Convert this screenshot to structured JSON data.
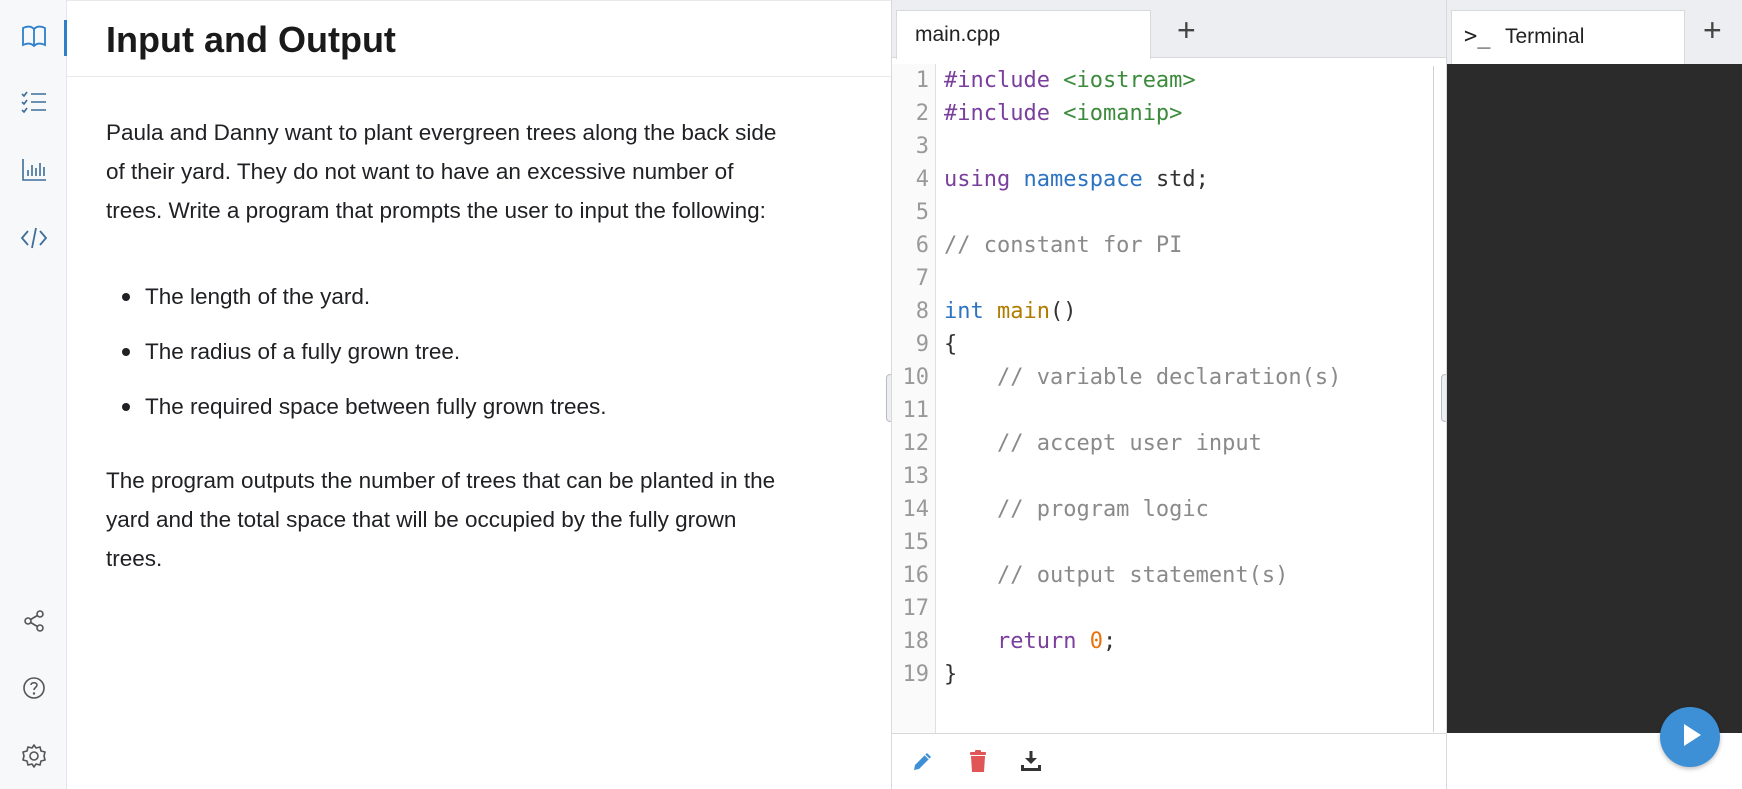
{
  "colors": {
    "accent": "#2f80c9",
    "terminal_bg": "#2b2b2b",
    "run_button": "#3d8fd6",
    "delete_icon": "#e05555"
  },
  "sidebar": {
    "items": [
      {
        "icon": "book-icon",
        "active": true
      },
      {
        "icon": "checklist-icon"
      },
      {
        "icon": "bar-chart-icon"
      },
      {
        "icon": "code-icon"
      },
      {
        "icon": "share-icon"
      },
      {
        "icon": "help-icon"
      },
      {
        "icon": "settings-icon"
      }
    ]
  },
  "guide": {
    "title": "Input and Output",
    "intro_lines": [
      "Paula and Danny want to plant evergreen trees along the back side",
      "of their yard. They do not want to have an excessive number of",
      "trees. Write a program that prompts the user to input the following:"
    ],
    "bullets": [
      "The length of the yard.",
      "The radius of a fully grown tree.",
      "The required space between fully grown trees."
    ],
    "outro_lines": [
      "The program outputs the number of trees that can be planted in the",
      "yard and the total space that will be occupied by the fully grown",
      "trees."
    ]
  },
  "editor": {
    "tab_label": "main.cpp",
    "add_tab_label": "+",
    "line_numbers": [
      "1",
      "2",
      "3",
      "4",
      "5",
      "6",
      "7",
      "8",
      "9",
      "10",
      "11",
      "12",
      "13",
      "14",
      "15",
      "16",
      "17",
      "18",
      "19"
    ],
    "code": [
      [
        {
          "t": "#include ",
          "c": "kw-purple"
        },
        {
          "t": "<iostream>",
          "c": "str-green"
        }
      ],
      [
        {
          "t": "#include ",
          "c": "kw-purple"
        },
        {
          "t": "<iomanip>",
          "c": "str-green"
        }
      ],
      [],
      [
        {
          "t": "using ",
          "c": "kw-purple"
        },
        {
          "t": "namespace ",
          "c": "kw-blue"
        },
        {
          "t": "std;",
          "c": ""
        }
      ],
      [],
      [
        {
          "t": "// constant for PI",
          "c": "comment"
        }
      ],
      [],
      [
        {
          "t": "int ",
          "c": "kw-blue"
        },
        {
          "t": "main",
          "c": "fn"
        },
        {
          "t": "()",
          "c": ""
        }
      ],
      [
        {
          "t": "{",
          "c": ""
        }
      ],
      [
        {
          "t": "    // variable declaration(s)",
          "c": "comment"
        }
      ],
      [],
      [
        {
          "t": "    // accept user input",
          "c": "comment"
        }
      ],
      [],
      [
        {
          "t": "    // program logic",
          "c": "comment"
        }
      ],
      [],
      [
        {
          "t": "    // output statement(s)",
          "c": "comment"
        }
      ],
      [],
      [
        {
          "t": "    return ",
          "c": "kw-purple"
        },
        {
          "t": "0",
          "c": "num"
        },
        {
          "t": ";",
          "c": ""
        }
      ],
      [
        {
          "t": "}",
          "c": ""
        }
      ]
    ],
    "toolbar": [
      "pencil-icon",
      "trash-icon",
      "download-icon"
    ]
  },
  "terminal": {
    "prompt_icon": ">_",
    "tab_label": "Terminal",
    "add_tab_label": "+"
  }
}
